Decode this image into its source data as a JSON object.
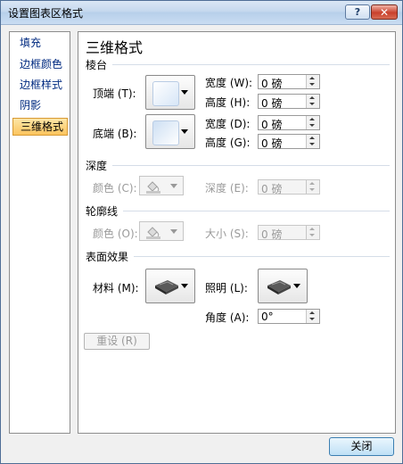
{
  "window": {
    "title": "设置图表区格式",
    "help_label": "?",
    "close_label": "✕"
  },
  "sidebar": {
    "items": [
      {
        "label": "填充"
      },
      {
        "label": "边框颜色"
      },
      {
        "label": "边框样式"
      },
      {
        "label": "阴影"
      },
      {
        "label": "三维格式",
        "selected": true
      }
    ]
  },
  "panel": {
    "title": "三维格式",
    "bevel": {
      "section_label": "棱台",
      "top_label": "顶端 (T):",
      "bottom_label": "底端 (B):",
      "top_width_label": "宽度 (W):",
      "top_width_value": "0 磅",
      "top_height_label": "高度 (H):",
      "top_height_value": "0 磅",
      "bottom_width_label": "宽度 (D):",
      "bottom_width_value": "0 磅",
      "bottom_height_label": "高度 (G):",
      "bottom_height_value": "0 磅"
    },
    "depth": {
      "section_label": "深度",
      "color_label": "颜色 (C):",
      "depth_label": "深度 (E):",
      "depth_value": "0 磅"
    },
    "contour": {
      "section_label": "轮廓线",
      "color_label": "颜色 (O):",
      "size_label": "大小 (S):",
      "size_value": "0 磅"
    },
    "surface": {
      "section_label": "表面效果",
      "material_label": "材料 (M):",
      "lighting_label": "照明 (L):",
      "angle_label": "角度 (A):",
      "angle_value": "0°"
    },
    "reset_label": "重设 (R)"
  },
  "footer": {
    "close_label": "关闭"
  },
  "colors": {
    "title_bar": "#c5d8ee",
    "selected_item": "#fbc45e",
    "link_text": "#002a80",
    "disabled_text": "#9a9a9a"
  }
}
